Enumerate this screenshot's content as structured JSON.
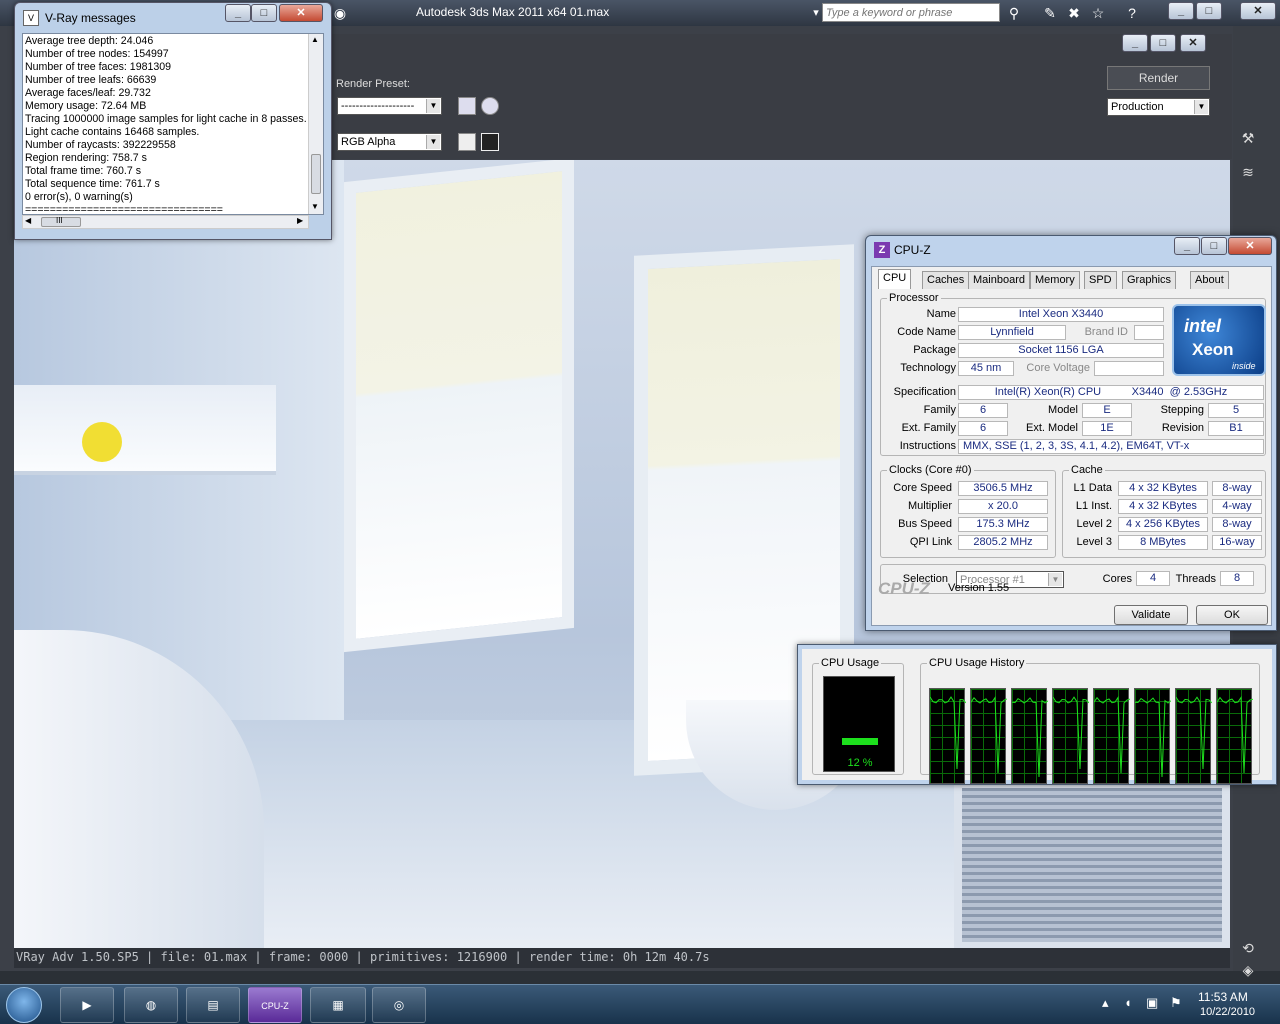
{
  "max_window": {
    "title": "Autodesk 3ds Max  2011 x64      01.max",
    "search_placeholder": "Type a keyword or phrase"
  },
  "frame_buffer": {
    "render_preset_label": "Render Preset:",
    "preset_value": "--------------------",
    "channel_value": "RGB Alpha",
    "render_button": "Render",
    "mode_value": "Production",
    "status_strip": "VRay Adv 1.50.SP5 | file: 01.max | frame: 0000 | primitives: 1216900 | render time: 0h 12m 40.7s"
  },
  "vray_messages": {
    "title": "V-Ray messages",
    "lines": [
      "Average tree depth: 24.046",
      "Number of tree nodes: 154997",
      "Number of tree faces: 1981309",
      "Number of tree leafs: 66639",
      "Average faces/leaf: 29.732",
      "Memory usage: 72.64 MB",
      "Tracing 1000000 image samples for light cache in 8 passes.",
      "Light cache contains 16468 samples.",
      "Number of raycasts: 392229558",
      "Region rendering: 758.7 s",
      "Total frame time: 760.7 s",
      "Total sequence time: 761.7 s",
      "0 error(s), 0 warning(s)",
      "================================"
    ],
    "hscroll_grip": "III"
  },
  "cpuz": {
    "title": "CPU-Z",
    "tabs": [
      "CPU",
      "Caches",
      "Mainboard",
      "Memory",
      "SPD",
      "Graphics",
      "About"
    ],
    "processor": {
      "group": "Processor",
      "name_label": "Name",
      "name": "Intel Xeon X3440",
      "codename_label": "Code Name",
      "codename": "Lynnfield",
      "brandid_label": "Brand ID",
      "package_label": "Package",
      "package": "Socket 1156 LGA",
      "technology_label": "Technology",
      "technology": "45 nm",
      "corevoltage_label": "Core Voltage",
      "spec_label": "Specification",
      "spec": "Intel(R) Xeon(R) CPU          X3440  @ 2.53GHz",
      "family_label": "Family",
      "family": "6",
      "model_label": "Model",
      "model": "E",
      "stepping_label": "Stepping",
      "stepping": "5",
      "extfamily_label": "Ext. Family",
      "extfamily": "6",
      "extmodel_label": "Ext. Model",
      "extmodel": "1E",
      "revision_label": "Revision",
      "revision": "B1",
      "instructions_label": "Instructions",
      "instructions": "MMX, SSE (1, 2, 3, 3S, 4.1, 4.2), EM64T, VT-x"
    },
    "intel_logo": {
      "brand": "intel",
      "product": "Xeon",
      "tag": "inside"
    },
    "clocks": {
      "group": "Clocks (Core #0)",
      "corespeed_label": "Core Speed",
      "corespeed": "3506.5 MHz",
      "multiplier_label": "Multiplier",
      "multiplier": "x 20.0",
      "busspeed_label": "Bus Speed",
      "busspeed": "175.3 MHz",
      "qpi_label": "QPI Link",
      "qpi": "2805.2 MHz"
    },
    "cache": {
      "group": "Cache",
      "rows": [
        {
          "label": "L1 Data",
          "size": "4 x 32 KBytes",
          "way": "8-way"
        },
        {
          "label": "L1 Inst.",
          "size": "4 x 32 KBytes",
          "way": "4-way"
        },
        {
          "label": "Level 2",
          "size": "4 x 256 KBytes",
          "way": "8-way"
        },
        {
          "label": "Level 3",
          "size": "8 MBytes",
          "way": "16-way"
        }
      ]
    },
    "selection_label": "Selection",
    "selection_value": "Processor #1",
    "cores_label": "Cores",
    "cores": "4",
    "threads_label": "Threads",
    "threads": "8",
    "brand": "CPU-Z",
    "version": "Version 1.55",
    "validate": "Validate",
    "ok": "OK"
  },
  "perf": {
    "usage_group": "CPU Usage",
    "history_group": "CPU Usage History",
    "usage_percent": "12 %",
    "usage_level": 0.12,
    "history_graph_count": 8,
    "graph_color": "#1de01d"
  },
  "taskbar": {
    "time": "11:53 AM",
    "date": "10/22/2010",
    "cpuz_button": "CPU-Z"
  }
}
